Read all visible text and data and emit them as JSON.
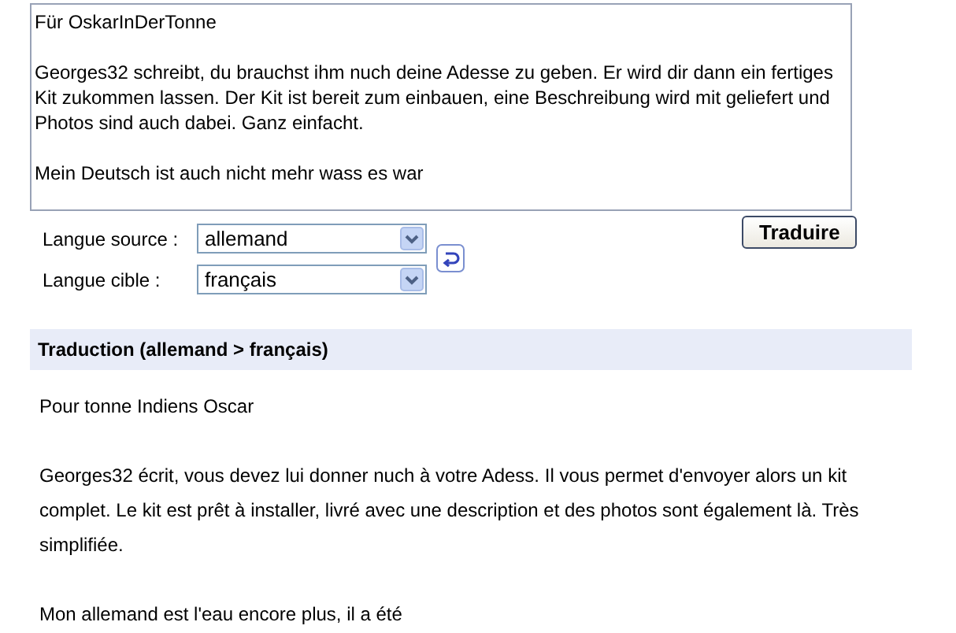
{
  "source_text": {
    "value": "Für OskarInDerTonne\n\nGeorges32 schreibt, du brauchst ihm nuch deine Adesse zu geben. Er wird dir dann ein fertiges Kit zukommen lassen. Der Kit ist bereit zum einbauen, eine Beschreibung wird mit geliefert und Photos sind auch dabei. Ganz einfacht.\n\nMein Deutsch ist auch nicht mehr wass es war "
  },
  "source_language": {
    "label": "Langue source :",
    "value": "allemand"
  },
  "target_language": {
    "label": "Langue cible :",
    "value": "français"
  },
  "translate_button": "Traduire",
  "result": {
    "heading": "Traduction (allemand > français)",
    "paragraphs": [
      "Pour tonne Indiens Oscar",
      "Georges32 écrit, vous devez lui donner nuch à votre Adess. Il vous permet d'envoyer alors un kit complet. Le kit est prêt à installer, livré avec une description et des photos sont également là. Très simplifiée.",
      "Mon allemand est l'eau encore plus, il a été"
    ]
  }
}
